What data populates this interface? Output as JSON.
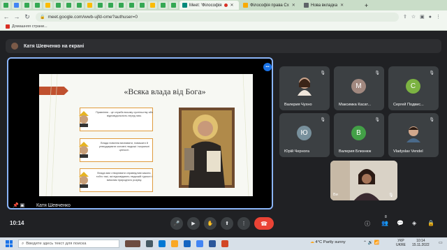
{
  "browser": {
    "tabs": [
      {
        "label": "Meet: 'Філософія",
        "active": true
      },
      {
        "label": "Філософія права Сх",
        "active": false
      },
      {
        "label": "Нова вкладка",
        "active": false
      }
    ],
    "url": "meet.google.com/wwb-ujfd-ome?authuser=0",
    "bookmark": "Домашняя страни..."
  },
  "meet": {
    "presenting_banner": "Катя Шевченко на екрані",
    "presenter_name": "Катя Шевченко",
    "time": "10:14",
    "participants": [
      {
        "name": "Валерия Чухно",
        "initial": "",
        "color": "#3c4043"
      },
      {
        "name": "Максимка Касат...",
        "initial": "М",
        "color": "#a1887f"
      },
      {
        "name": "Сергей Подвис...",
        "initial": "С",
        "color": "#7cb342"
      },
      {
        "name": "Юрій Черногa",
        "initial": "Ю",
        "color": "#78909c"
      },
      {
        "name": "Валерия Близнюк",
        "initial": "В",
        "color": "#43a047"
      },
      {
        "name": "Vladyslav Vendel",
        "initial": "",
        "color": "#3c4043"
      }
    ],
    "self_label": "Ви",
    "participant_count": "8"
  },
  "slide": {
    "title": "«Всяка влада від Бога»",
    "bullets": [
      "Правління - це служба всьому суспільству або відповідальність перед ним.",
      "Влада повинна визнавати, поважати й утверджувати основні людські і моральні цінності.",
      "Влада має створювати справедливі закони, тобто такі, які відповідають людській гідності і вимогам природного розуму."
    ]
  },
  "taskbar": {
    "search_placeholder": "Введите здесь текст для поиска",
    "weather": "4°C  Partly sunny",
    "lang_top": "УКР",
    "lang_bottom": "UKRE",
    "clock_time": "10:14",
    "clock_date": "15.11.2022"
  }
}
